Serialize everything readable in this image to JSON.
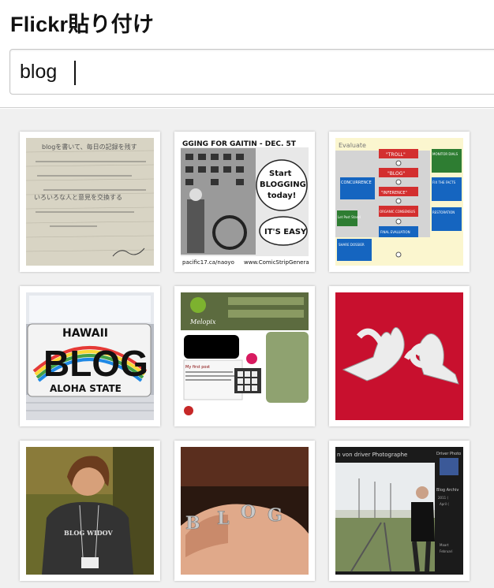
{
  "app": {
    "title": "Flickr貼り付け"
  },
  "search": {
    "value": "blog",
    "placeholder": ""
  },
  "photos": [
    {
      "name": "handwritten-note",
      "text_lines": [
        "blogを書いて、毎日の記録を残す",
        "いろいろな人と意見を交換する"
      ]
    },
    {
      "name": "blogging-comic",
      "banner": "GGING FOR GAITIN - DEC. 5T",
      "bubble1": [
        "Start",
        "BLOGGING",
        "today!"
      ],
      "bubble2": "IT'S EASY",
      "credit_left": "pacific17.ca/naoyo",
      "credit_right": "www.ComicStripGenerat"
    },
    {
      "name": "flow-diagram",
      "header": "Evaluate",
      "boxes": [
        "\"TROLL\"",
        "\"BLOG\"",
        "CONCURRENCE",
        "\"INFERENCE\"",
        "ORGANIC CONSENSUS",
        "FINAL EVALUATION",
        "SHARE DOSSIER",
        "Let Post Stand",
        "MONITOR DIALS",
        "FIX THE FACTS",
        "RESTORATION"
      ]
    },
    {
      "name": "hawaii-blog-plate",
      "state": "HAWAII",
      "word": "BLOG",
      "slogan": "ALOHA STATE"
    },
    {
      "name": "website-template",
      "brand": "Melopix",
      "heading": "My first post"
    },
    {
      "name": "sign-language-hands"
    },
    {
      "name": "blog-widow-shirt",
      "shirt_text": "BLOG WIDOV"
    },
    {
      "name": "blog-rings",
      "rings": [
        "B",
        "L",
        "O",
        "G"
      ]
    },
    {
      "name": "photographer-blog",
      "banner": "n von driver Photographe",
      "sidebar_title": "Driver Photo",
      "archive": "Blog Archiv",
      "years": [
        "2011 (",
        "April (",
        "Maart",
        "Februari"
      ]
    }
  ],
  "colors": {
    "header_bg": "#ffffff",
    "grid_bg": "#f0f0f0",
    "divider": "#cfcfcf",
    "text": "#111111"
  }
}
